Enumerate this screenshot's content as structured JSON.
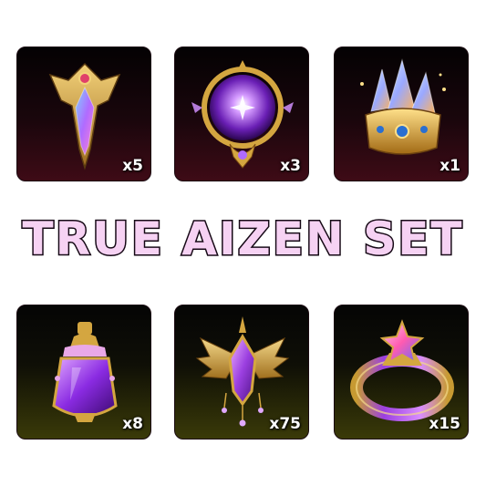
{
  "title": "TRUE AIZEN SET",
  "colors": {
    "title_fill": "#f6d2f3",
    "title_outline": "#150815",
    "top_tile_bg": "#3e0b16",
    "bottom_tile_bg": "#3a3a08",
    "gold": "#d4a640",
    "purple": "#9b3fe0"
  },
  "items": [
    {
      "icon": "gold-crest-amulet-icon",
      "quantity": "x5"
    },
    {
      "icon": "purple-orb-emblem-icon",
      "quantity": "x3"
    },
    {
      "icon": "crystal-crown-icon",
      "quantity": "x1"
    },
    {
      "icon": "purple-potion-flask-icon",
      "quantity": "x8"
    },
    {
      "icon": "winged-gem-brooch-icon",
      "quantity": "x75"
    },
    {
      "icon": "star-gem-ring-icon",
      "quantity": "x15"
    }
  ]
}
